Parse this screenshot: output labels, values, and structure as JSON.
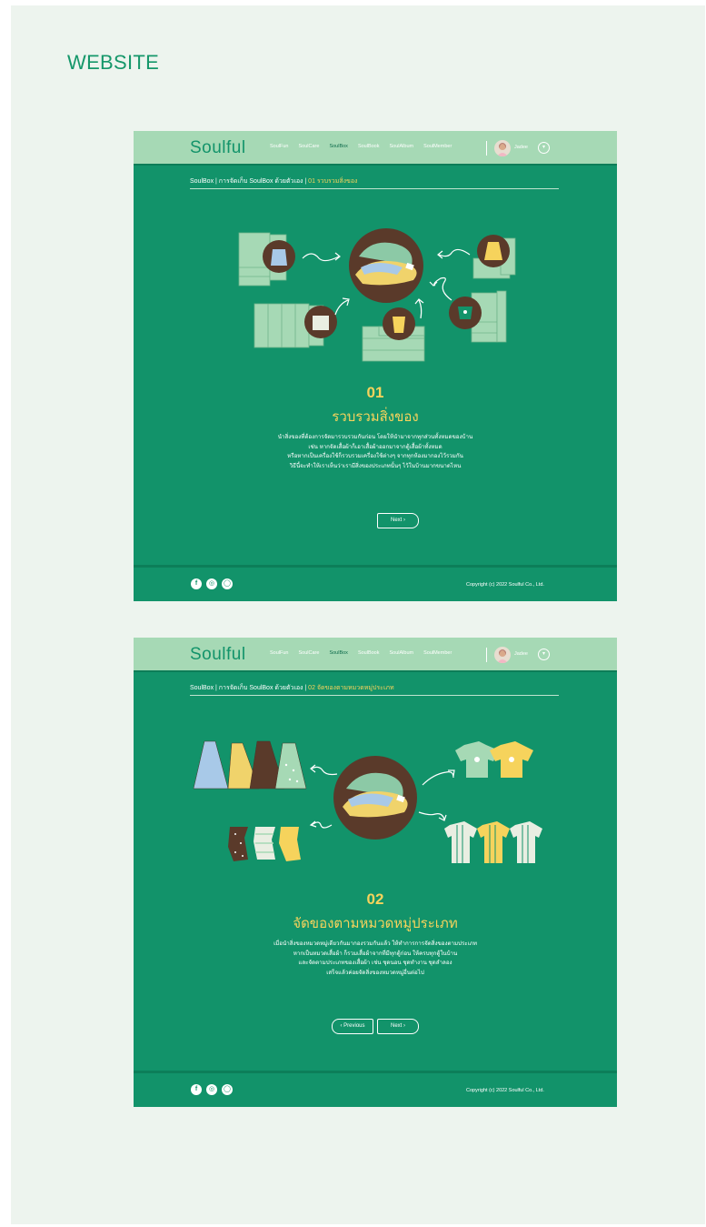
{
  "board": {
    "title": "WEBSITE"
  },
  "nav": {
    "logo": "Soulful",
    "items": [
      "SoulFun",
      "SoulCare",
      "SoulBox",
      "SoulBook",
      "SoulAlbum",
      "SoulMember"
    ],
    "active_index": 2,
    "user_name": "Jadee"
  },
  "screens": [
    {
      "crumb_base": "SoulBox | การจัดเก็บ SoulBox ด้วยตัวเอง | ",
      "crumb_current": "01 รวบรวมสิ่งของ",
      "step_number": "01",
      "step_title": "รวบรวมสิ่งของ",
      "description": [
        "นำสิ่งของที่ต้องการจัดมารวบรวมกันก่อน โดยให้นำมาจากทุกส่วนทั้งหมดของบ้าน",
        "เช่น หากจัดเสื้อผ้าก็เอาเสื้อผ้าออกมาจากตู้เสื้อผ้าทั้งหมด",
        "หรือหากเป็นเครื่องใช้ก็รวบรวมเครื่องใช้ต่างๆ จากทุกห้องมากองไว้รวมกัน",
        "วิธีนี้จะทำให้เราเห็นว่าเรามีสิ่งของประเภทนั้นๆ ไว้ในบ้านมากขนาดไหน"
      ],
      "next_label": "Next ›"
    },
    {
      "crumb_base": "SoulBox | การจัดเก็บ SoulBox ด้วยตัวเอง | ",
      "crumb_current": "02 จัดของตามหมวดหมู่ประเภท",
      "step_number": "02",
      "step_title": "จัดของตามหมวดหมู่ประเภท",
      "description": [
        "เมื่อนำสิ่งของหมวดหมู่เดียวกันมากองรวมกันแล้ว ให้ทำการการจัดสิ่งของตามประเภท",
        "หากเป็นหมวดเสื้อผ้า ก็รวมเสื้อผ้าจากที่มีทุกตู้ก่อน ให้ครบทุกตู้ในบ้าน",
        "และจัดตามประเภทของเสื้อผ้า เช่น ชุดนอน ชุดทำงาน ชุดลำลอง",
        "เสร็จแล้วค่อยจัดสิ่งของหมวดหมู่อื่นต่อไป"
      ],
      "prev_label": "‹ Previous",
      "next_label": "Next ›"
    }
  ],
  "footer": {
    "copyright": "Copyright (c) 2022 Soulful Co., Ltd.",
    "social_icons": [
      "facebook-icon",
      "instagram-icon",
      "line-icon"
    ]
  },
  "colors": {
    "board_bg": "#edf4ee",
    "primary": "#12936a",
    "nav_bg": "#a6d9b5",
    "accent_yellow": "#f6d35c",
    "brown": "#5a3a2a"
  }
}
